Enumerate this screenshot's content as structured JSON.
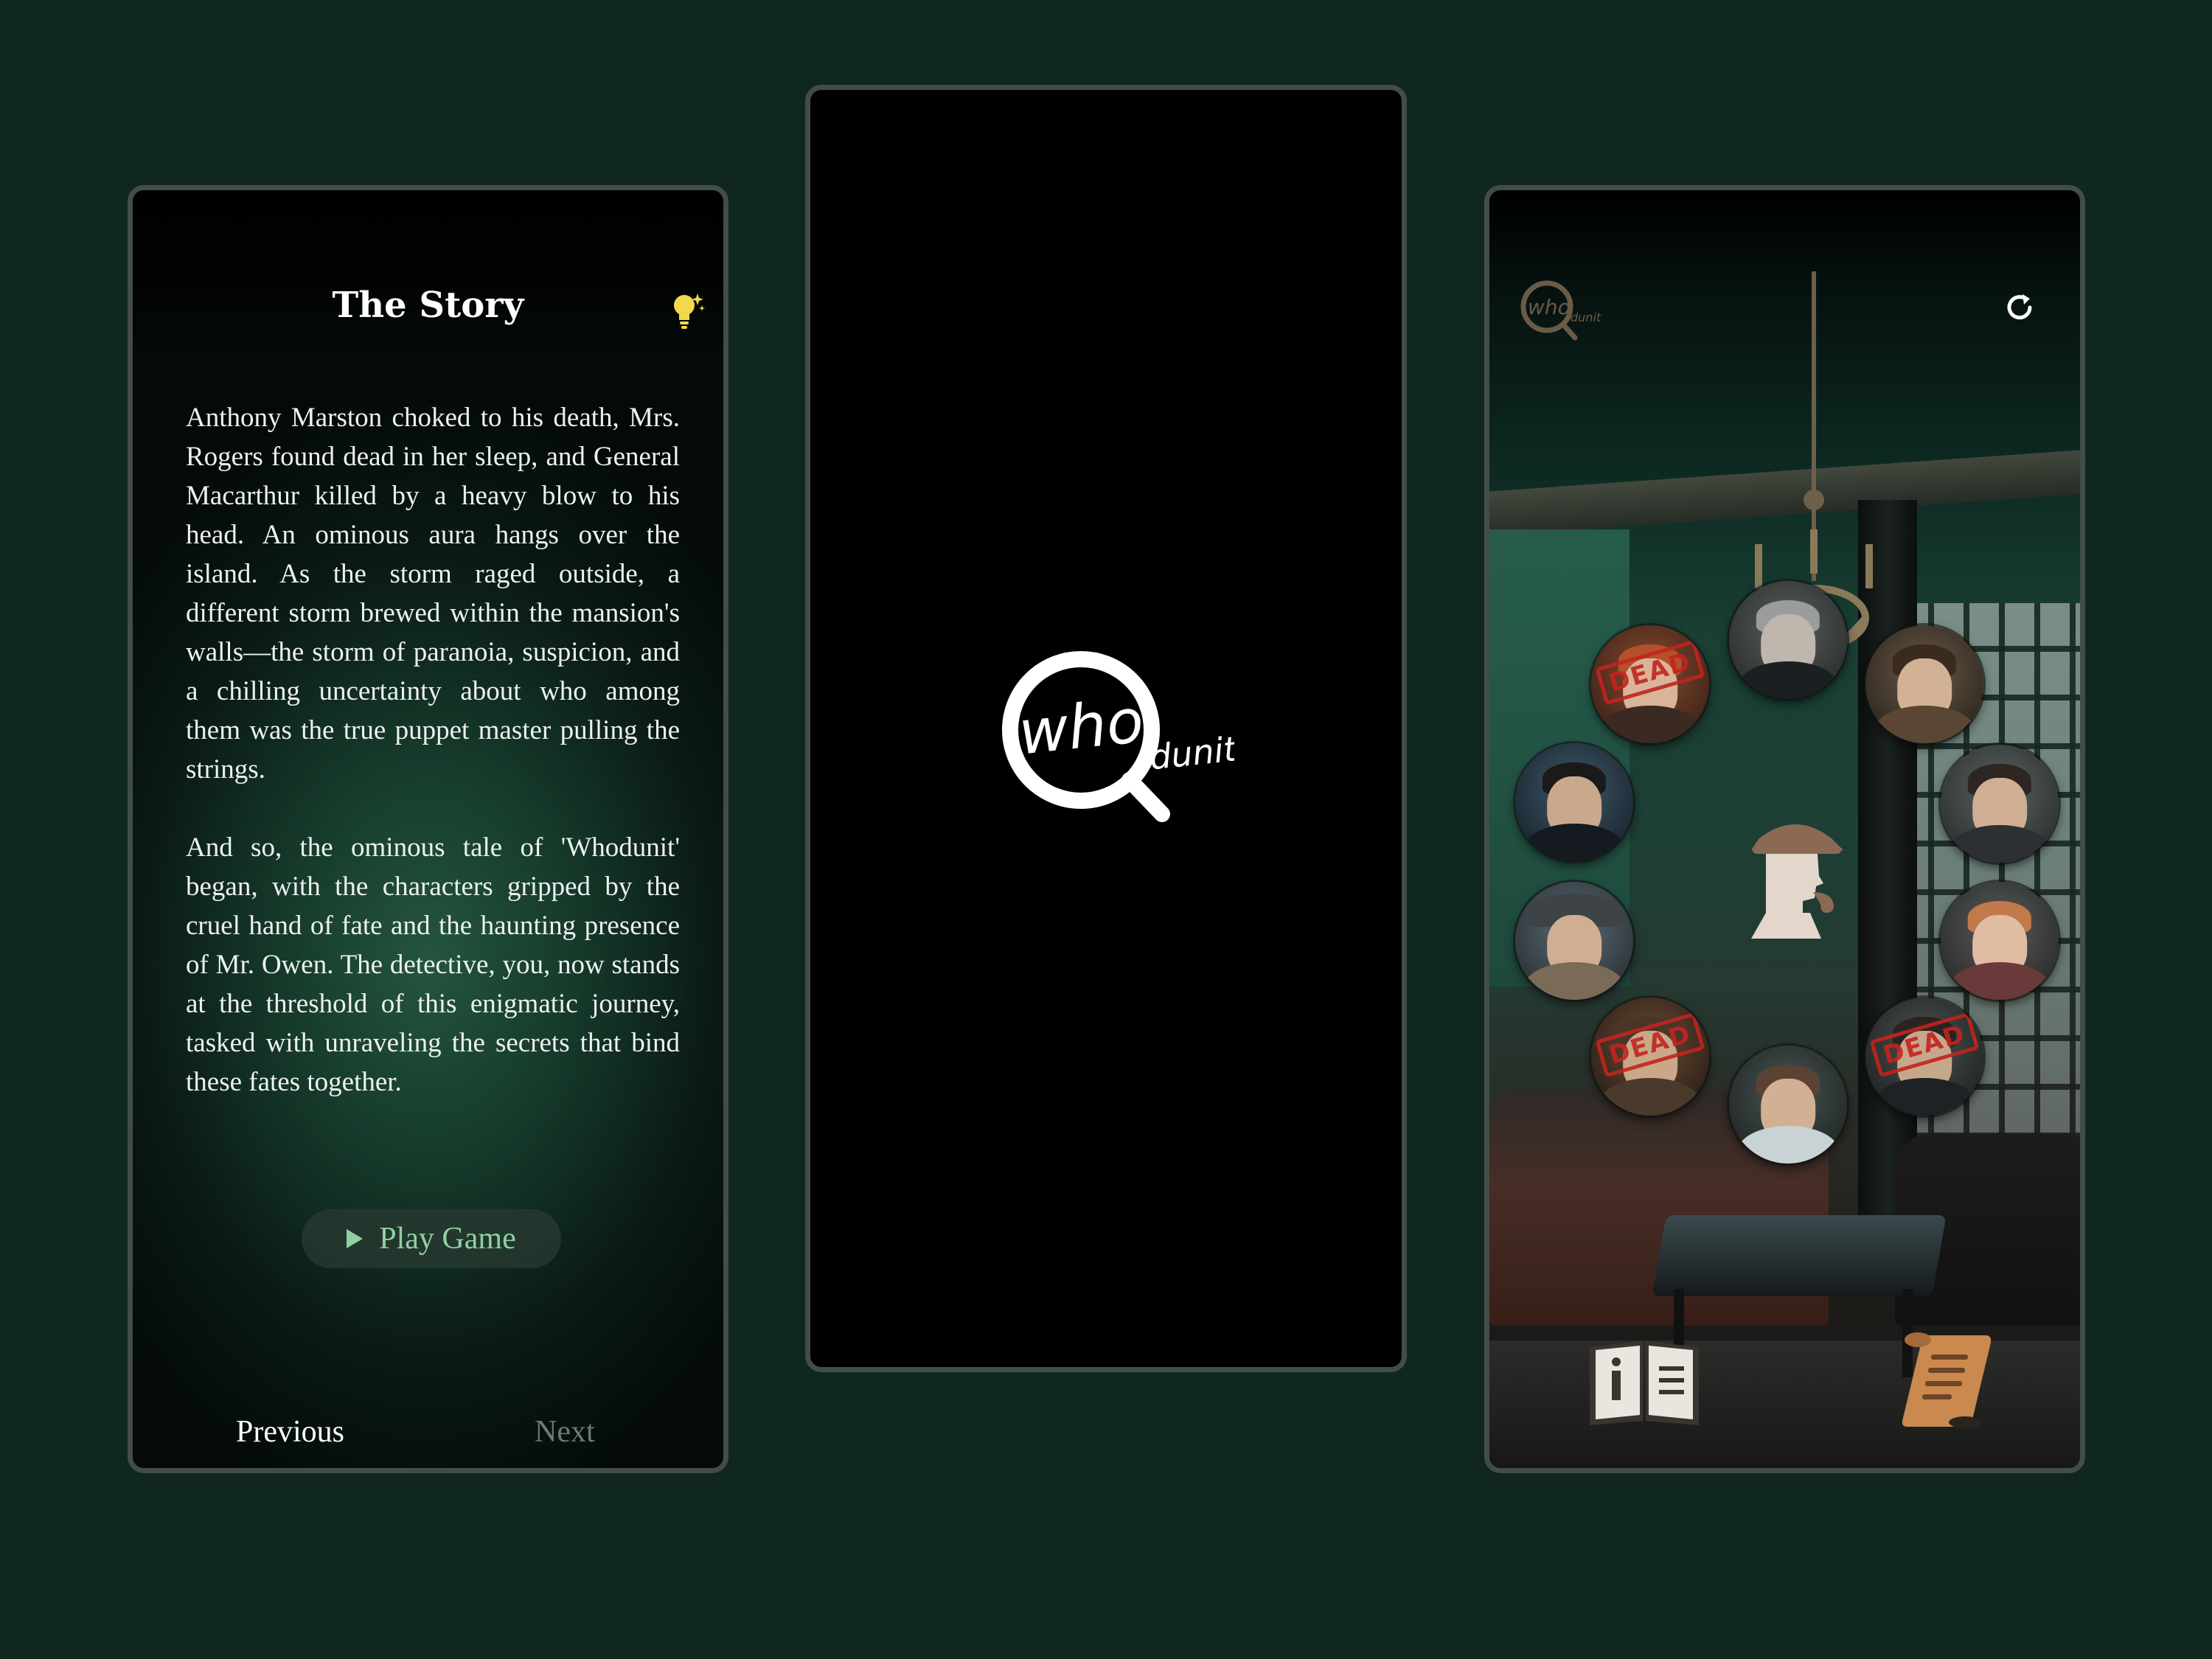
{
  "story_screen": {
    "title": "The Story",
    "paragraphs": [
      "Anthony Marston choked to his death, Mrs. Rogers found dead in her sleep, and General Macarthur killed by a heavy blow to his head. An ominous aura hangs over the island. As the storm raged outside, a different storm brewed within the mansion's walls—the storm of paranoia, suspicion, and a chilling uncertainty about who among them was the true puppet master pulling the strings.",
      "And so, the ominous tale of 'Whodunit' began, with the characters gripped by the cruel hand of fate and the haunting presence of Mr. Owen. The detective, you, now stands at the threshold of this enigmatic journey, tasked with unraveling the secrets that bind these fates together."
    ],
    "play_button": "Play Game",
    "previous": "Previous",
    "next": "Next",
    "hint_icon": "lightbulb-icon"
  },
  "splash_screen": {
    "logo_main": "who",
    "logo_sub": "dunit"
  },
  "room_screen": {
    "logo_main": "who",
    "logo_sub": "dunit",
    "refresh_icon": "refresh-icon",
    "dead_label": "DEAD",
    "characters": [
      {
        "id": "suspect-1",
        "dead": true
      },
      {
        "id": "suspect-2",
        "dead": false
      },
      {
        "id": "suspect-3",
        "dead": false
      },
      {
        "id": "suspect-4",
        "dead": false
      },
      {
        "id": "suspect-5",
        "dead": false
      },
      {
        "id": "suspect-6",
        "dead": false
      },
      {
        "id": "suspect-7",
        "dead": false
      },
      {
        "id": "suspect-8",
        "dead": true
      },
      {
        "id": "suspect-9",
        "dead": false
      },
      {
        "id": "suspect-10",
        "dead": true
      }
    ],
    "bottom_icons": [
      "guidebook-icon",
      "scroll-icon"
    ]
  },
  "colors": {
    "background": "#10271d",
    "accent_green": "#8fd1a4",
    "dead_red": "#c3241f",
    "frame": "#434d48"
  }
}
